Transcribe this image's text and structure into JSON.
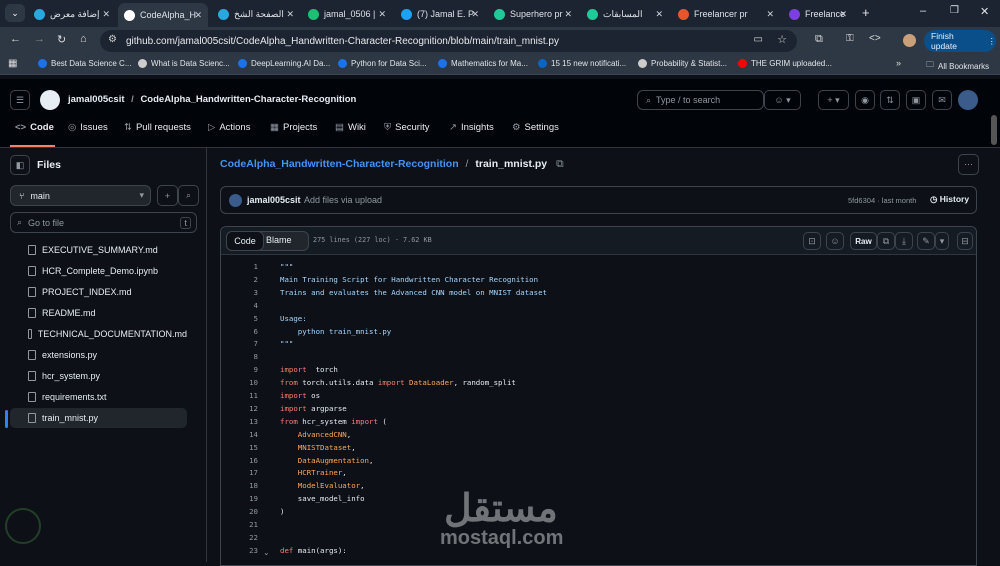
{
  "browser": {
    "tabs": [
      {
        "label": "إضافة معرض",
        "color": "#29a8e0"
      },
      {
        "label": "CodeAlpha_H",
        "color": "#ffffff",
        "active": true
      },
      {
        "label": "الصفحة الشخ",
        "color": "#29a8e0"
      },
      {
        "label": "jamal_0506 |",
        "color": "#1dbf73"
      },
      {
        "label": "(7) Jamal E. P",
        "color": "#1da1f2"
      },
      {
        "label": "Superhero pr",
        "color": "#20c997"
      },
      {
        "label": "المسابقات",
        "color": "#20c997"
      },
      {
        "label": "Freelancer pr",
        "color": "#e8552d"
      },
      {
        "label": "Freelance",
        "color": "#7b3fe4"
      }
    ],
    "url": "github.com/jamal005csit/CodeAlpha_Handwritten-Character-Recognition/blob/main/train_mnist.py",
    "finish_update": "Finish update",
    "bookmarks": [
      "Best Data Science C...",
      "What is Data Scienc...",
      "DeepLearning.AI Da...",
      "Python for Data Sci...",
      "Mathematics for Ma...",
      "15 15 new notificati...",
      "Probability & Statist...",
      "THE GRIM uploaded..."
    ],
    "all_bookmarks": "All Bookmarks"
  },
  "github": {
    "owner": "jamal005csit",
    "sep": "/",
    "repo": "CodeAlpha_Handwritten-Character-Recognition",
    "search_placeholder": "Type / to search",
    "nav": [
      "Code",
      "Issues",
      "Pull requests",
      "Actions",
      "Projects",
      "Wiki",
      "Security",
      "Insights",
      "Settings"
    ]
  },
  "sidebar": {
    "title": "Files",
    "branch": "main",
    "goto_placeholder": "Go to file",
    "shortcut": "t",
    "files": [
      "EXECUTIVE_SUMMARY.md",
      "HCR_Complete_Demo.ipynb",
      "PROJECT_INDEX.md",
      "README.md",
      "TECHNICAL_DOCUMENTATION.md",
      "extensions.py",
      "hcr_system.py",
      "requirements.txt",
      "train_mnist.py"
    ]
  },
  "file": {
    "repo_link": "CodeAlpha_Handwritten-Character-Recognition",
    "sep": "/",
    "name": "train_mnist.py",
    "commit_author": "jamal005csit",
    "commit_msg": "Add files via upload",
    "commit_meta": "5fd6304 · last month",
    "history": "History",
    "tab_code": "Code",
    "tab_blame": "Blame",
    "stats": "275 lines (227 loc) · 7.62 KB",
    "raw": "Raw"
  },
  "code": [
    [
      [
        "s",
        "\"\"\""
      ]
    ],
    [
      [
        "s",
        "Main Training Script for Handwritten Character Recognition"
      ]
    ],
    [
      [
        "s",
        "Trains and evaluates the Advanced CNN model on MNIST dataset"
      ]
    ],
    [],
    [
      [
        "s",
        "Usage:"
      ]
    ],
    [
      [
        "s",
        "    python train_mnist.py"
      ]
    ],
    [
      [
        "s",
        "\"\"\""
      ]
    ],
    [],
    [
      [
        "k",
        "import"
      ],
      [
        "",
        "  torch"
      ]
    ],
    [
      [
        "k",
        "from"
      ],
      [
        "",
        " torch.utils.data "
      ],
      [
        "k",
        "import"
      ],
      [
        "c",
        " DataLoader"
      ],
      [
        "",
        ", random_split"
      ]
    ],
    [
      [
        "k",
        "import"
      ],
      [
        "",
        " os"
      ]
    ],
    [
      [
        "k",
        "import"
      ],
      [
        "",
        " argparse"
      ]
    ],
    [
      [
        "k",
        "from"
      ],
      [
        "",
        " hcr_system "
      ],
      [
        "k",
        "import"
      ],
      [
        "",
        " ("
      ]
    ],
    [
      [
        "c",
        "    AdvancedCNN"
      ],
      [
        "",
        ","
      ]
    ],
    [
      [
        "c",
        "    MNISTDataset"
      ],
      [
        "",
        ","
      ]
    ],
    [
      [
        "c",
        "    DataAugmentation"
      ],
      [
        "",
        ","
      ]
    ],
    [
      [
        "c",
        "    HCRTrainer"
      ],
      [
        "",
        ","
      ]
    ],
    [
      [
        "c",
        "    ModelEvaluator"
      ],
      [
        "",
        ","
      ]
    ],
    [
      [
        "",
        "    save_model_info"
      ]
    ],
    [
      [
        "",
        ")"
      ]
    ],
    [],
    [],
    [
      [
        "k",
        "def"
      ],
      [
        "",
        " main(args):"
      ]
    ]
  ],
  "watermark": {
    "arabic": "مستقل",
    "latin": "mostaql.com"
  }
}
